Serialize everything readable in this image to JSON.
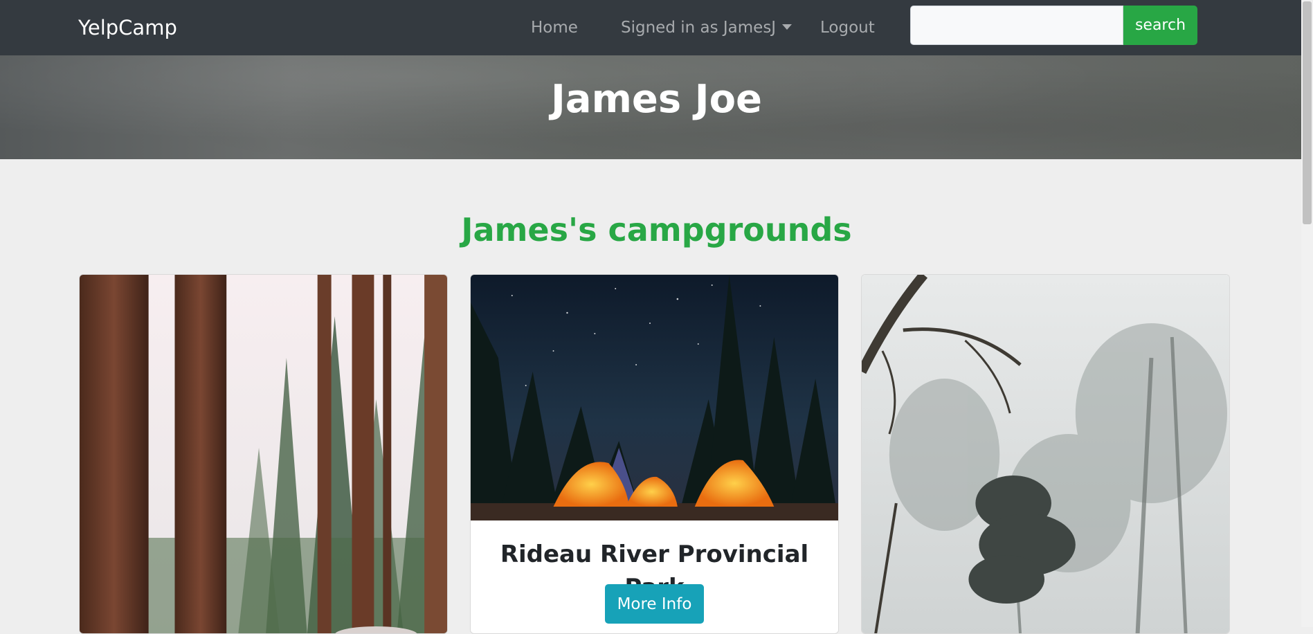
{
  "navbar": {
    "brand": "YelpCamp",
    "links": {
      "home": "Home",
      "user": "Signed in as JamesJ",
      "logout": "Logout"
    },
    "search": {
      "value": "",
      "placeholder": "",
      "button_label": "search"
    },
    "colors": {
      "background": "#343a40",
      "search_button": "#28a745"
    }
  },
  "hero": {
    "title": "James Joe"
  },
  "section": {
    "heading": "James's campgrounds",
    "heading_color": "#28a745"
  },
  "campgrounds": [
    {
      "image": "tall-pine-forest-photo"
    },
    {
      "image": "tents-under-starry-night-photo",
      "title": "Rideau River Provincial Park",
      "button_label": "More Info",
      "button_color": "#17a2b8"
    },
    {
      "image": "misty-forest-photo"
    }
  ]
}
